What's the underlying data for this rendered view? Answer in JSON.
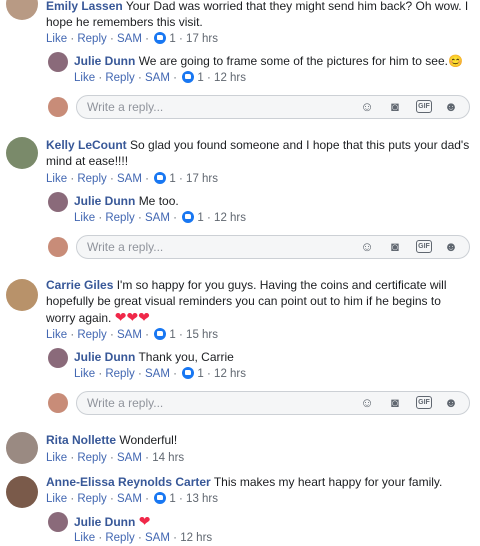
{
  "actions": {
    "like": "Like",
    "reply": "Reply",
    "sam": "SAM",
    "sep": "·"
  },
  "reply_placeholder": "Write a reply...",
  "icons": {
    "like": "like-thumb-icon",
    "emoji": "emoji-icon",
    "camera": "camera-icon",
    "gif": "gif-icon",
    "sticker": "sticker-icon"
  },
  "gif_label": "GIF",
  "threads": [
    {
      "author": "Emily Lassen",
      "text": "Your Dad was worried that they might send him back? Oh wow. I hope he remembers this visit.",
      "likes": "1",
      "time": "17 hrs",
      "reply": {
        "author": "Julie Dunn",
        "text": "We are going to frame some of the pictures for him to see.",
        "emoji": "😊",
        "likes": "1",
        "time": "12 hrs"
      }
    },
    {
      "author": "Kelly LeCount",
      "text": "So glad you found someone and I hope that this puts your dad's mind at ease!!!!",
      "likes": "1",
      "time": "17 hrs",
      "reply": {
        "author": "Julie Dunn",
        "text": "Me too.",
        "likes": "1",
        "time": "12 hrs"
      }
    },
    {
      "author": "Carrie Giles",
      "text": "I'm so happy for you guys. Having the coins and certificate will hopefully be great visual reminders you can point out to him if he begins to worry again.",
      "hearts": "❤❤❤",
      "likes": "1",
      "time": "15 hrs",
      "reply": {
        "author": "Julie Dunn",
        "text": "Thank you, Carrie",
        "likes": "1",
        "time": "12 hrs"
      }
    },
    {
      "author": "Rita Nollette",
      "text": "Wonderful!",
      "time": "14 hrs"
    },
    {
      "author": "Anne-Elissa Reynolds Carter",
      "text": "This makes my heart happy for your family.",
      "likes": "1",
      "time": "13 hrs",
      "reply": {
        "author": "Julie Dunn",
        "hearts": "❤",
        "time": "12 hrs"
      }
    }
  ],
  "colors": {
    "link": "#385898",
    "action": "#4267b2",
    "meta": "#606770",
    "like_blue": "#1877f2",
    "heart": "#f02849",
    "reply_bg": "#f5f6f7",
    "reply_border": "#ccd0d5"
  }
}
